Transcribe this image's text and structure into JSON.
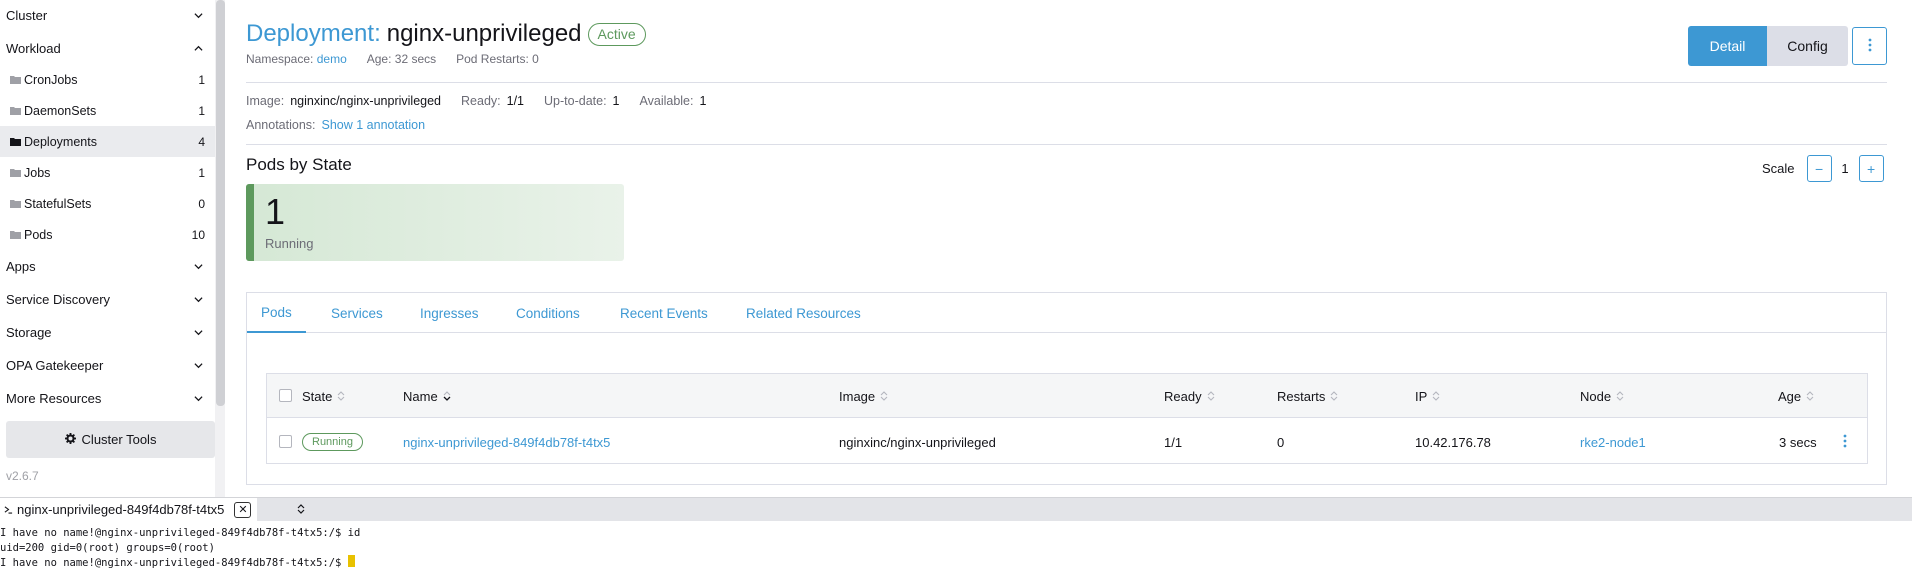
{
  "sidebar": {
    "groups": {
      "cluster": "Cluster",
      "workload": "Workload",
      "apps": "Apps",
      "service_discovery": "Service Discovery",
      "storage": "Storage",
      "opa": "OPA Gatekeeper",
      "more": "More Resources"
    },
    "items": [
      {
        "label": "CronJobs",
        "count": "1"
      },
      {
        "label": "DaemonSets",
        "count": "1"
      },
      {
        "label": "Deployments",
        "count": "4"
      },
      {
        "label": "Jobs",
        "count": "1"
      },
      {
        "label": "StatefulSets",
        "count": "0"
      },
      {
        "label": "Pods",
        "count": "10"
      }
    ],
    "cluster_tools": "Cluster Tools",
    "version": "v2.6.7"
  },
  "header": {
    "kind": "Deployment:",
    "name": "nginx-unprivileged",
    "status": "Active",
    "namespace_label": "Namespace:",
    "namespace": "demo",
    "age": "Age: 32 secs",
    "restarts": "Pod Restarts: 0",
    "detail_btn": "Detail",
    "config_btn": "Config"
  },
  "meta": {
    "image_label": "Image:",
    "image": "nginxinc/nginx-unprivileged",
    "ready_label": "Ready:",
    "ready": "1/1",
    "uptodate_label": "Up-to-date:",
    "uptodate": "1",
    "available_label": "Available:",
    "available": "1",
    "annotations_label": "Annotations:",
    "annotations_link": "Show 1 annotation"
  },
  "pods_by_state": {
    "title": "Pods by State",
    "scale_label": "Scale",
    "scale_value": "1",
    "count": "1",
    "state": "Running"
  },
  "tabs": [
    "Pods",
    "Services",
    "Ingresses",
    "Conditions",
    "Recent Events",
    "Related Resources"
  ],
  "table": {
    "headers": [
      "State",
      "Name",
      "Image",
      "Ready",
      "Restarts",
      "IP",
      "Node",
      "Age"
    ],
    "row": {
      "state": "Running",
      "name": "nginx-unprivileged-849f4db78f-t4tx5",
      "image": "nginxinc/nginx-unprivileged",
      "ready": "1/1",
      "restarts": "0",
      "ip": "10.42.176.78",
      "node": "rke2-node1",
      "age": "3 secs"
    }
  },
  "terminal": {
    "tab_label": "nginx-unprivileged-849f4db78f-t4tx5",
    "lines": [
      "I have no name!@nginx-unprivileged-849f4db78f-t4tx5:/$ id",
      "uid=200 gid=0(root) groups=0(root)",
      "I have no name!@nginx-unprivileged-849f4db78f-t4tx5:/$ "
    ]
  },
  "colors": {
    "accent": "#3d98d3",
    "success": "#5d995d"
  }
}
